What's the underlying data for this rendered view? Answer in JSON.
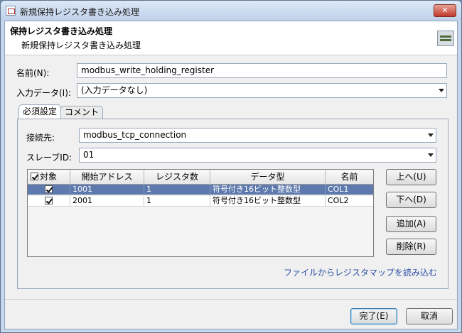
{
  "window": {
    "title": "新規保持レジスタ書き込み処理",
    "close_label": "✕"
  },
  "header": {
    "title": "保持レジスタ書き込み処理",
    "subtitle": "新規保持レジスタ書き込み処理",
    "icon": "register-device-icon"
  },
  "form": {
    "name_label": "名前(N):",
    "name_value": "modbus_write_holding_register",
    "input_label": "入力データ(I):",
    "input_value": "(入力データなし)"
  },
  "tabs": [
    {
      "label": "必須設定"
    },
    {
      "label": "コメント"
    }
  ],
  "required": {
    "connection_label": "接続先:",
    "connection_value": "modbus_tcp_connection",
    "slave_label": "スレーブID:",
    "slave_value": "01"
  },
  "table": {
    "columns": [
      "対象",
      "開始アドレス",
      "レジスタ数",
      "データ型",
      "名前"
    ],
    "rows": [
      {
        "checked": true,
        "address": "1001",
        "count": "1",
        "type": "符号付き16ビット整数型",
        "name": "COL1",
        "selected": true
      },
      {
        "checked": true,
        "address": "2001",
        "count": "1",
        "type": "符号付き16ビット整数型",
        "name": "COL2",
        "selected": false
      }
    ]
  },
  "side_buttons": {
    "up": "上へ(U)",
    "down": "下へ(D)",
    "add": "追加(A)",
    "delete": "削除(R)"
  },
  "load_link": "ファイルからレジスタマップを読み込む",
  "footer": {
    "finish": "完了(E)",
    "cancel": "取消"
  }
}
